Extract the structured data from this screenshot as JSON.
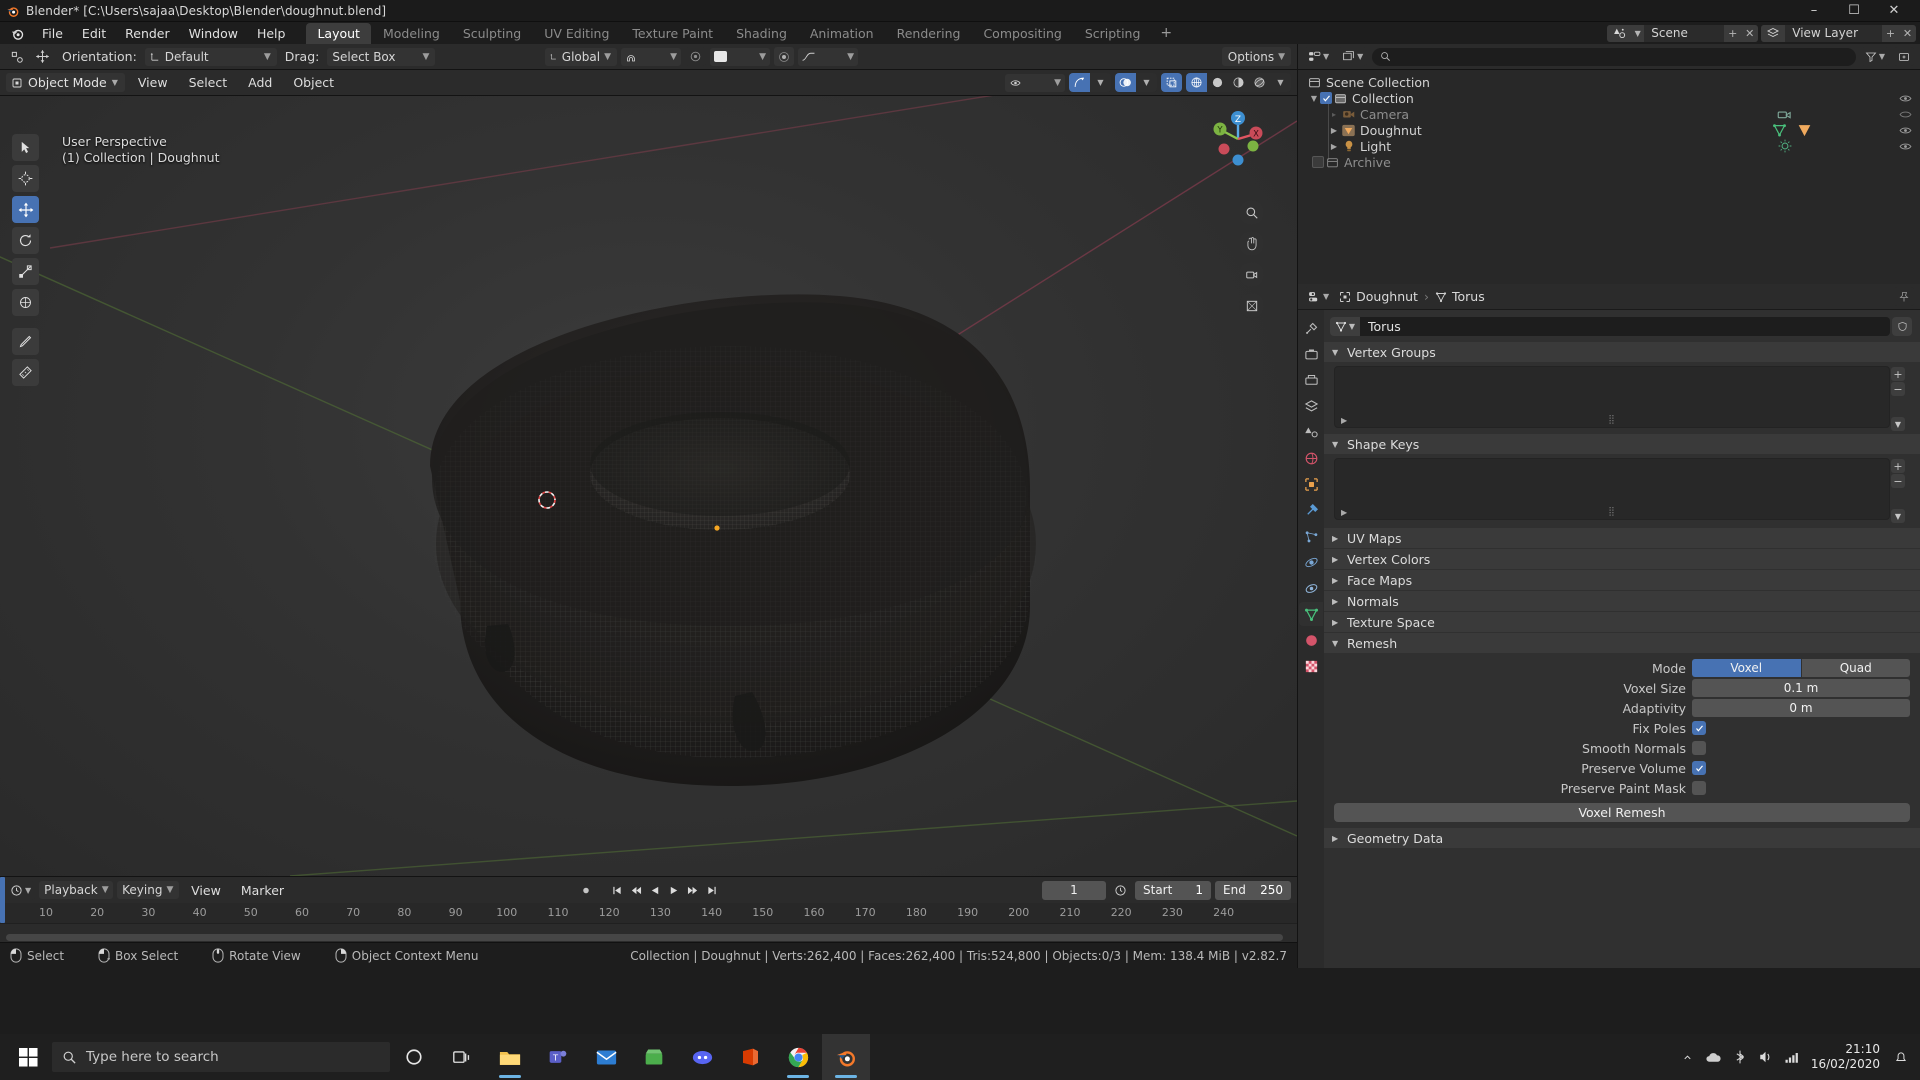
{
  "window": {
    "title": "Blender* [C:\\Users\\sajaa\\Desktop\\Blender\\doughnut.blend]",
    "minimize": "–",
    "maximize": "☐",
    "close": "✕"
  },
  "topbar": {
    "menus": [
      "File",
      "Edit",
      "Render",
      "Window",
      "Help"
    ],
    "workspaces": [
      "Layout",
      "Modeling",
      "Sculpting",
      "UV Editing",
      "Texture Paint",
      "Shading",
      "Animation",
      "Rendering",
      "Compositing",
      "Scripting"
    ],
    "active_workspace": "Layout",
    "add_workspace": "+",
    "scene_name": "Scene",
    "view_layer_name": "View Layer"
  },
  "viewport_header": {
    "mode": "Object Mode",
    "menus": [
      "View",
      "Select",
      "Add",
      "Object"
    ],
    "orientation_label": "Orientation:",
    "orientation_value": "Default",
    "drag_label": "Drag:",
    "drag_value": "Select Box",
    "transform_value": "Global",
    "options_label": "Options"
  },
  "viewport": {
    "perspective_text": "User Perspective",
    "collection_text": "(1) Collection | Doughnut",
    "gizmo": {
      "z": "Z",
      "y": "Y",
      "x": "X"
    }
  },
  "outliner": {
    "rows": [
      {
        "name": "Scene Collection",
        "icon": "scene-collection-icon",
        "indent": 8,
        "type": "root"
      },
      {
        "name": "Collection",
        "icon": "collection-icon",
        "indent": 22,
        "type": "collection",
        "checked": true,
        "disclosure": "▼"
      },
      {
        "name": "Camera",
        "icon": "camera-icon",
        "indent": 42,
        "type": "object",
        "dim": true,
        "data_icon": "camera-data-icon"
      },
      {
        "name": "Doughnut",
        "icon": "mesh-object-icon",
        "indent": 42,
        "type": "object",
        "disclosure": "▶",
        "data_icon": "mesh-data-icon",
        "modifier_icon": "mesh-triangle-icon"
      },
      {
        "name": "Light",
        "icon": "light-object-icon",
        "indent": 42,
        "type": "object",
        "disclosure": "▶",
        "data_icon": "light-data-icon"
      },
      {
        "name": "Archive",
        "icon": "archive-icon",
        "indent": 26,
        "type": "collection",
        "dim": true
      }
    ]
  },
  "properties": {
    "breadcrumb": {
      "object": "Doughnut",
      "data": "Torus"
    },
    "datablock_name": "Torus",
    "panels": [
      {
        "label": "Vertex Groups",
        "open": true,
        "kind": "list"
      },
      {
        "label": "Shape Keys",
        "open": true,
        "kind": "list"
      },
      {
        "label": "UV Maps",
        "open": false,
        "kind": "header"
      },
      {
        "label": "Vertex Colors",
        "open": false,
        "kind": "header"
      },
      {
        "label": "Face Maps",
        "open": false,
        "kind": "header"
      },
      {
        "label": "Normals",
        "open": false,
        "kind": "header"
      },
      {
        "label": "Texture Space",
        "open": false,
        "kind": "header"
      },
      {
        "label": "Remesh",
        "open": true,
        "kind": "remesh"
      },
      {
        "label": "Geometry Data",
        "open": false,
        "kind": "header"
      }
    ],
    "remesh": {
      "mode_label": "Mode",
      "mode_options": [
        "Voxel",
        "Quad"
      ],
      "mode_selected": "Voxel",
      "voxel_size_label": "Voxel Size",
      "voxel_size_value": "0.1 m",
      "adaptivity_label": "Adaptivity",
      "adaptivity_value": "0 m",
      "fix_poles_label": "Fix Poles",
      "fix_poles_checked": true,
      "smooth_normals_label": "Smooth Normals",
      "smooth_normals_checked": false,
      "preserve_volume_label": "Preserve Volume",
      "preserve_volume_checked": true,
      "preserve_paint_mask_label": "Preserve Paint Mask",
      "preserve_paint_mask_checked": false,
      "voxel_remesh_button": "Voxel Remesh"
    }
  },
  "timeline": {
    "playback": "Playback",
    "keying": "Keying",
    "view": "View",
    "marker": "Marker",
    "current_frame": "1",
    "start_label": "Start",
    "start_value": "1",
    "end_label": "End",
    "end_value": "250",
    "ticks": [
      "10",
      "20",
      "30",
      "40",
      "50",
      "60",
      "70",
      "80",
      "90",
      "100",
      "110",
      "120",
      "130",
      "140",
      "150",
      "160",
      "170",
      "180",
      "190",
      "200",
      "210",
      "220",
      "230",
      "240"
    ]
  },
  "statusbar": {
    "items": [
      {
        "icon": "mouse-left-icon",
        "label": "Select"
      },
      {
        "icon": "mouse-left-drag-icon",
        "label": "Box Select"
      },
      {
        "icon": "mouse-middle-icon",
        "label": "Rotate View"
      },
      {
        "icon": "mouse-right-icon",
        "label": "Object Context Menu"
      }
    ],
    "scene_stats": "Collection | Doughnut | Verts:262,400 | Faces:262,400 | Tris:524,800 | Objects:0/3 | Mem: 138.4 MiB | v2.82.7"
  },
  "taskbar": {
    "search_placeholder": "Type here to search",
    "apps": [
      "cortana-icon",
      "task-view-icon",
      "file-explorer-icon",
      "teams-icon",
      "mail-icon",
      "store-icon",
      "discord-icon",
      "office-icon",
      "chrome-icon",
      "blender-icon"
    ],
    "time": "21:10",
    "date": "16/02/2020"
  }
}
